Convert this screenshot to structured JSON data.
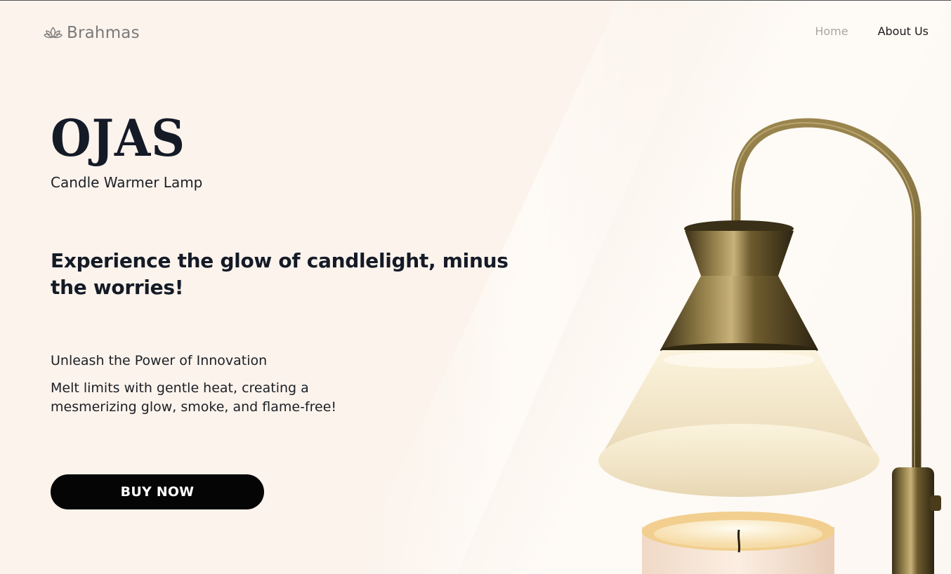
{
  "brand": {
    "name": "Brahmas",
    "icon": "lotus-icon"
  },
  "nav": {
    "home": "Home",
    "about": "About Us"
  },
  "hero": {
    "title": "OJAS",
    "subtitle": "Candle Warmer Lamp",
    "headline": "Experience the glow of candlelight, minus the worries!",
    "tagline": "Unleash the Power of Innovation",
    "description": "Melt limits with gentle heat, creating a mesmerizing glow, smoke, and flame-free!",
    "cta": "BUY NOW"
  },
  "colors": {
    "background": "#fbf3ec",
    "heading": "#141a26",
    "button": "#050505",
    "nav_muted": "#a9a6a3",
    "brass": "#7a6431"
  }
}
